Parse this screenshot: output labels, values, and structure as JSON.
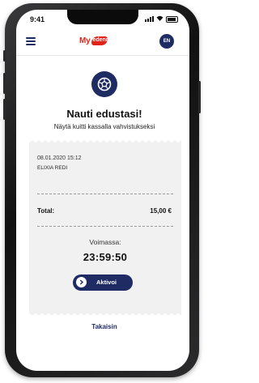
{
  "status_bar": {
    "time": "9:41"
  },
  "header": {
    "logo_text_left": "My",
    "logo_text_right": "edenred",
    "language_button": "EN"
  },
  "hero": {
    "icon": "soccer-ball-icon"
  },
  "title": "Nauti edustasi!",
  "subtitle": "Näytä kuitti kassalla vahvistukseksi",
  "receipt": {
    "date": "08.01.2020 15:12",
    "store": "ELIXIA REDI",
    "total_label": "Total:",
    "total_value": "15,00 €",
    "valid_label": "Voimassa:",
    "timer": "23:59:50",
    "activate_label": "Aktivoi"
  },
  "back_link": "Takaisin",
  "colors": {
    "primary": "#1f2b63",
    "brand_red": "#e2231a",
    "receipt_bg": "#f1f1f1"
  }
}
